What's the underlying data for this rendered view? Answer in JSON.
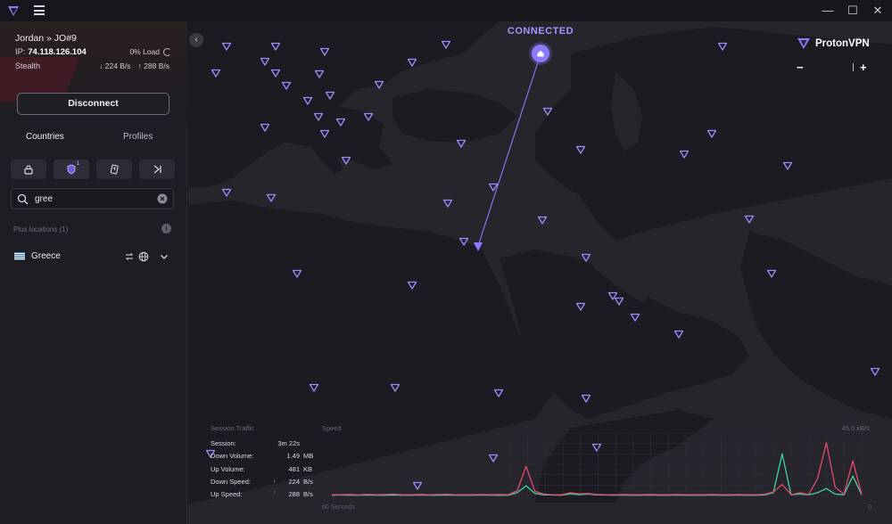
{
  "window": {
    "minimize": "—",
    "maximize": "☐",
    "close": "✕"
  },
  "connection": {
    "server_name": "Jordan » JO#9",
    "ip_label": "IP:",
    "ip_value": "74.118.126.104",
    "load": "0% Load",
    "protocol": "Stealth",
    "down_speed": "↓ 224 B/s",
    "up_speed": "↑ 288 B/s",
    "disconnect_label": "Disconnect"
  },
  "tabs": {
    "countries": "Countries",
    "profiles": "Profiles"
  },
  "filter_icons": [
    "lock-icon",
    "shield-icon",
    "card-icon",
    "forward-icon"
  ],
  "filter_badge": "1",
  "search": {
    "value": "gree",
    "placeholder": "Search"
  },
  "results": {
    "section_label": "Plus locations (1)",
    "info": "i",
    "items": [
      {
        "country": "Greece"
      }
    ]
  },
  "map": {
    "status": "CONNECTED",
    "brand": "ProtonVPN",
    "zoom_out": "−",
    "zoom_in": "+",
    "collapse": "‹"
  },
  "traffic": {
    "title": "Session Traffic",
    "speed_title": "Speed",
    "max_label": "45.0 kB/s",
    "x_start": "60 Seconds",
    "x_end": "0",
    "rows": [
      {
        "label": "Session:",
        "value": "3m 22s",
        "unit": ""
      },
      {
        "label": "Down Volume:",
        "value": "1.49",
        "unit": "MB"
      },
      {
        "label": "Up Volume:",
        "value": "481",
        "unit": "KB"
      },
      {
        "label": "Down Speed:",
        "value": "224",
        "unit": "B/s",
        "arrow": "↓"
      },
      {
        "label": "Up Speed:",
        "value": "288",
        "unit": "B/s",
        "arrow": "↑"
      }
    ],
    "colors": {
      "down": "#3fd1a0",
      "up": "#e2496a"
    }
  },
  "chart_data": {
    "type": "line",
    "title": "",
    "xlabel": "60 Seconds",
    "ylabel": "",
    "ylim": [
      0,
      45
    ],
    "x": [
      0,
      1,
      2,
      3,
      4,
      5,
      6,
      7,
      8,
      9,
      10,
      11,
      12,
      13,
      14,
      15,
      16,
      17,
      18,
      19,
      20,
      21,
      22,
      23,
      24,
      25,
      26,
      27,
      28,
      29,
      30,
      31,
      32,
      33,
      34,
      35,
      36,
      37,
      38,
      39,
      40,
      41,
      42,
      43,
      44,
      45,
      46,
      47,
      48,
      49,
      50,
      51,
      52,
      53,
      54,
      55,
      56,
      57,
      58,
      59,
      60
    ],
    "series": [
      {
        "values": [
          0.5,
          0.6,
          0.8,
          0.4,
          0.9,
          0.5,
          0.7,
          1.0,
          0.5,
          0.6,
          0.8,
          0.5,
          0.7,
          0.9,
          0.6,
          0.5,
          0.6,
          0.8,
          0.5,
          0.7,
          0.6,
          3.5,
          21,
          3.0,
          1.0,
          0.6,
          0.5,
          2.0,
          1.2,
          1.5,
          0.8,
          0.6,
          0.5,
          0.7,
          0.6,
          0.5,
          0.8,
          0.6,
          0.5,
          0.7,
          0.6,
          0.5,
          0.6,
          0.8,
          0.6,
          0.5,
          0.7,
          0.6,
          0.5,
          0.9,
          2.5,
          8.0,
          0.6,
          2.0,
          0.8,
          12,
          38,
          6.0,
          1.0,
          25,
          0.8
        ]
      },
      {
        "values": [
          0.2,
          0.3,
          0.2,
          0.2,
          0.3,
          0.2,
          0.2,
          0.3,
          0.2,
          0.2,
          0.3,
          0.2,
          0.2,
          0.3,
          0.2,
          0.2,
          0.2,
          0.3,
          0.2,
          0.2,
          0.2,
          2.0,
          7.0,
          1.5,
          0.5,
          0.3,
          0.2,
          1.2,
          0.6,
          1.0,
          0.4,
          0.3,
          0.2,
          0.3,
          0.2,
          0.2,
          0.3,
          0.2,
          0.2,
          0.3,
          0.2,
          0.2,
          0.2,
          0.3,
          0.2,
          0.2,
          0.3,
          0.2,
          0.2,
          0.4,
          2.0,
          30,
          0.5,
          1.0,
          0.5,
          2.0,
          5.0,
          1.0,
          0.5,
          14,
          0.5
        ]
      }
    ]
  }
}
